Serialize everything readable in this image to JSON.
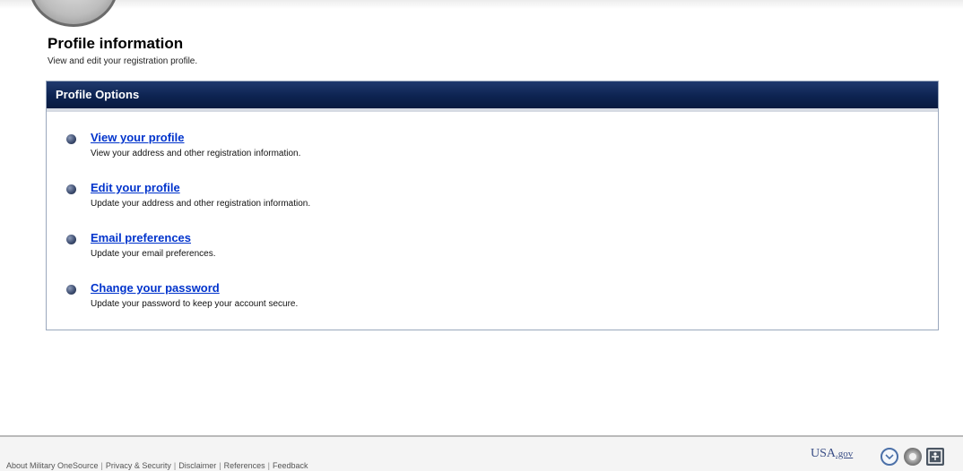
{
  "header": {
    "title": "Profile information",
    "subtitle": "View and edit your registration profile."
  },
  "panel": {
    "title": "Profile Options",
    "options": [
      {
        "label": "View your profile",
        "description": "View your address and other registration information."
      },
      {
        "label": "Edit your profile",
        "description": "Update your address and other registration information."
      },
      {
        "label": "Email preferences",
        "description": "Update your email preferences."
      },
      {
        "label": "Change your password",
        "description": "Update your password to keep your account secure."
      }
    ]
  },
  "footer": {
    "links": [
      "About Military OneSource",
      "Privacy & Security",
      "Disclaimer",
      "References",
      "Feedback"
    ],
    "separator": "|",
    "usa_gov_main": "USA",
    "usa_gov_dot": ".gov",
    "icons": [
      "feedback-icon",
      "seal-icon",
      "accessibility-icon"
    ]
  },
  "colors": {
    "header_bar": "#0d2351",
    "link": "#0033cc",
    "footer_bg": "#f4f4f4"
  }
}
